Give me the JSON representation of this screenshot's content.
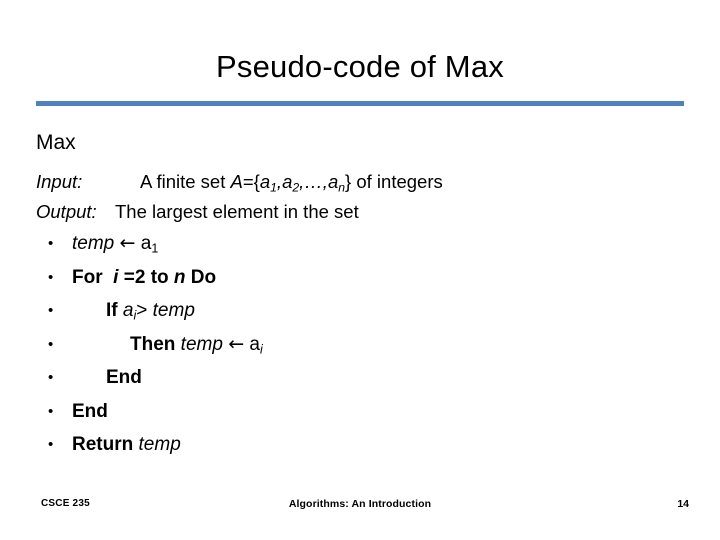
{
  "slide": {
    "title": "Pseudo-code of Max",
    "rule_color": "#4F81BD",
    "algorithm_name": "Max",
    "io": {
      "input_label": "Input:",
      "input_text_1": "A finite set ",
      "input_set_var": "A",
      "input_eq_open": "={",
      "input_a1": "a",
      "input_a1_sub": "1",
      "input_comma1": ",",
      "input_a2": "a",
      "input_a2_sub": "2",
      "input_ellipsis": ",…,",
      "input_an": "a",
      "input_an_sub": "n",
      "input_close": "} of integers",
      "output_label": "Output:",
      "output_text": "The largest element in the set"
    },
    "steps": [
      {
        "bullet": "•",
        "indent": 0,
        "text": "temp ← a1",
        "tokens": [
          {
            "t": "temp",
            "style": "italic"
          },
          {
            "t": " ",
            "style": "plain"
          },
          {
            "t": "←",
            "style": "arrow"
          },
          {
            "t": " a",
            "style": "plain"
          },
          {
            "t": "1",
            "style": "sub"
          }
        ]
      },
      {
        "bullet": "•",
        "indent": 0,
        "text": "For i =2 to n Do",
        "tokens": [
          {
            "t": "For",
            "style": "bold"
          },
          {
            "t": "  ",
            "style": "plain"
          },
          {
            "t": "i",
            "style": "bolditalic"
          },
          {
            "t": " =2 ",
            "style": "bold"
          },
          {
            "t": "to",
            "style": "bold"
          },
          {
            "t": " ",
            "style": "plain"
          },
          {
            "t": "n",
            "style": "bolditalic"
          },
          {
            "t": " Do",
            "style": "bold"
          }
        ]
      },
      {
        "bullet": "•",
        "indent": 1,
        "text": "If ai> temp",
        "tokens": [
          {
            "t": "If",
            "style": "bold"
          },
          {
            "t": " ",
            "style": "plain"
          },
          {
            "t": "a",
            "style": "italic"
          },
          {
            "t": "i",
            "style": "subitalic"
          },
          {
            "t": "> ",
            "style": "plain"
          },
          {
            "t": "temp",
            "style": "italic"
          }
        ]
      },
      {
        "bullet": "•",
        "indent": 2,
        "text": "Then temp ← ai",
        "tokens": [
          {
            "t": "Then",
            "style": "bold"
          },
          {
            "t": " ",
            "style": "plain"
          },
          {
            "t": "temp",
            "style": "italic"
          },
          {
            "t": " ",
            "style": "plain"
          },
          {
            "t": "←",
            "style": "arrow"
          },
          {
            "t": " a",
            "style": "plain"
          },
          {
            "t": "i",
            "style": "subitalic"
          }
        ]
      },
      {
        "bullet": "•",
        "indent": 3,
        "text": "End",
        "tokens": [
          {
            "t": "End",
            "style": "bold"
          }
        ]
      },
      {
        "bullet": "•",
        "indent": 0,
        "text": "End",
        "tokens": [
          {
            "t": "End",
            "style": "bold"
          }
        ]
      },
      {
        "bullet": "•",
        "indent": 0,
        "text": "Return temp",
        "tokens": [
          {
            "t": "Return",
            "style": "bold"
          },
          {
            "t": " ",
            "style": "plain"
          },
          {
            "t": "temp",
            "style": "italic"
          }
        ]
      }
    ]
  },
  "footer": {
    "course": "CSCE 235",
    "subject": "Algorithms: An Introduction",
    "page_number": "14"
  }
}
